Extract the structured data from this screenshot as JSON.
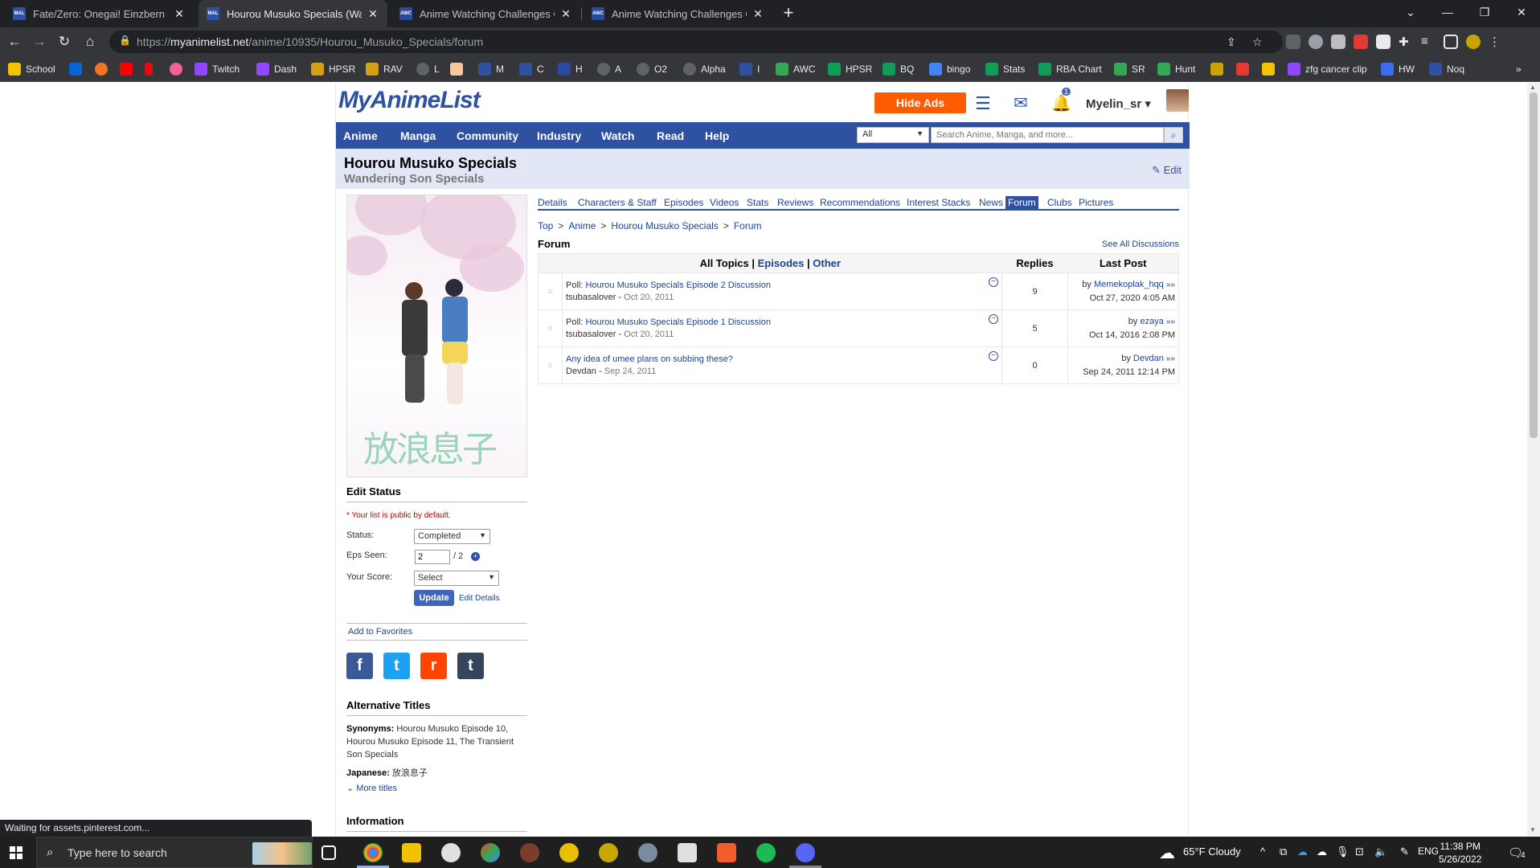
{
  "browser": {
    "tabs": [
      {
        "label": "Fate/Zero: Onegai! Einzbern Sou",
        "favicon": "MAL",
        "active": false
      },
      {
        "label": "Hourou Musuko Specials (Wande",
        "favicon": "MAL",
        "active": true
      },
      {
        "label": "Anime Watching Challenges Club",
        "favicon": "AWC",
        "active": false
      },
      {
        "label": "Anime Watching Challenges Club",
        "favicon": "AWC",
        "active": false
      }
    ],
    "url_prefix": "https://",
    "url_host": "myanimelist.net",
    "url_path": "/anime/10935/Hourou_Musuko_Specials/forum",
    "bookmarks": [
      "School",
      "Twitch",
      "Dash",
      "HPSR",
      "RAV",
      "L",
      "M",
      "C",
      "H",
      "A",
      "O2",
      "Alpha",
      "I",
      "AWC",
      "HPSR",
      "BQ",
      "bingo",
      "Stats",
      "RBA Chart",
      "SR",
      "Hunt",
      "zfg cancer clip",
      "HW",
      "Noq"
    ],
    "status_text": "Waiting for assets.pinterest.com..."
  },
  "site": {
    "logo": "MyAnimeList",
    "hide_ads": "Hide Ads",
    "notif_count": "1",
    "username": "Myelin_sr",
    "nav": [
      "Anime",
      "Manga",
      "Community",
      "Industry",
      "Watch",
      "Read",
      "Help"
    ],
    "search_scope": "All",
    "search_placeholder": "Search Anime, Manga, and more..."
  },
  "title": {
    "main": "Hourou Musuko Specials",
    "english": "Wandering Son Specials",
    "edit": "Edit"
  },
  "cover": {
    "text": "放浪息子"
  },
  "edit_status": {
    "heading": "Edit Status",
    "public_note": "* Your list is public by default.",
    "status_label": "Status:",
    "status_value": "Completed",
    "eps_label": "Eps Seen:",
    "eps_value": "2",
    "eps_total": "/ 2",
    "score_label": "Your Score:",
    "score_value": "Select",
    "update": "Update",
    "edit_details": "Edit Details"
  },
  "add_favorites": "Add to Favorites",
  "social": {
    "facebook": "f",
    "twitter": "t",
    "reddit": "r",
    "tumblr": "t"
  },
  "alt_titles": {
    "heading": "Alternative Titles",
    "synonyms_label": "Synonyms:",
    "synonyms": "Hourou Musuko Episode 10, Hourou Musuko Episode 11, The Transient Son Specials",
    "japanese_label": "Japanese:",
    "japanese": "放浪息子",
    "more": "More titles"
  },
  "info_heading": "Information",
  "subnav": [
    "Details",
    "Characters & Staff",
    "Episodes",
    "Videos",
    "Stats",
    "Reviews",
    "Recommendations",
    "Interest Stacks",
    "News",
    "Forum",
    "Clubs",
    "Pictures"
  ],
  "breadcrumb": [
    "Top",
    "Anime",
    "Hourou Musuko Specials",
    "Forum"
  ],
  "forum": {
    "heading": "Forum",
    "see_all": "See All Discussions",
    "filter_all": "All Topics",
    "filter_episodes": "Episodes",
    "filter_other": "Other",
    "col_replies": "Replies",
    "col_last": "Last Post",
    "topics": [
      {
        "prefix": "Poll: ",
        "title": "Hourou Musuko Specials Episode 2 Discussion",
        "author": "tsubasalover",
        "date": "Oct 20, 2011",
        "replies": "9",
        "last_by": "Memekoplak_hqq",
        "last_date": "Oct 27, 2020 4:05 AM"
      },
      {
        "prefix": "Poll: ",
        "title": "Hourou Musuko Specials Episode 1 Discussion",
        "author": "tsubasalover",
        "date": "Oct 20, 2011",
        "replies": "5",
        "last_by": "ezaya",
        "last_date": "Oct 14, 2016 2:08 PM"
      },
      {
        "prefix": "",
        "title": "Any idea of umee plans on subbing these?",
        "author": "Devdan",
        "date": "Sep 24, 2011",
        "replies": "0",
        "last_by": "Devdan",
        "last_date": "Sep 24, 2011 12:14 PM"
      }
    ]
  },
  "taskbar": {
    "search_placeholder": "Type here to search",
    "weather": "65°F  Cloudy",
    "lang": "ENG",
    "time": "11:38 PM",
    "date": "5/26/2022",
    "notif_count": "4"
  },
  "colors": {
    "brand": "#2e51a2",
    "hide_ads": "#ff5c00",
    "link": "#1c439b",
    "title_bg": "#e1e7f5"
  }
}
